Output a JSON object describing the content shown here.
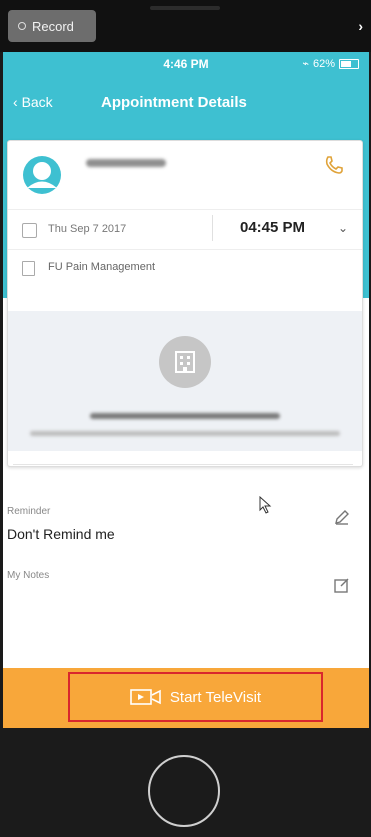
{
  "recorder": {
    "label": "Record"
  },
  "status_bar": {
    "time": "4:46 PM",
    "battery_pct": "62%"
  },
  "nav": {
    "back_label": "Back",
    "title": "Appointment Details"
  },
  "appointment": {
    "date": "Thu Sep 7 2017",
    "time": "04:45 PM",
    "location": "FU Pain Management"
  },
  "reminder": {
    "label": "Reminder",
    "value": "Don't Remind me"
  },
  "notes": {
    "label": "My Notes"
  },
  "televisit": {
    "label": "Start TeleVisit"
  },
  "colors": {
    "accent": "#3ec0d1",
    "action": "#f8a73a",
    "highlight": "#d9272d",
    "phone": "#e0a33a"
  }
}
